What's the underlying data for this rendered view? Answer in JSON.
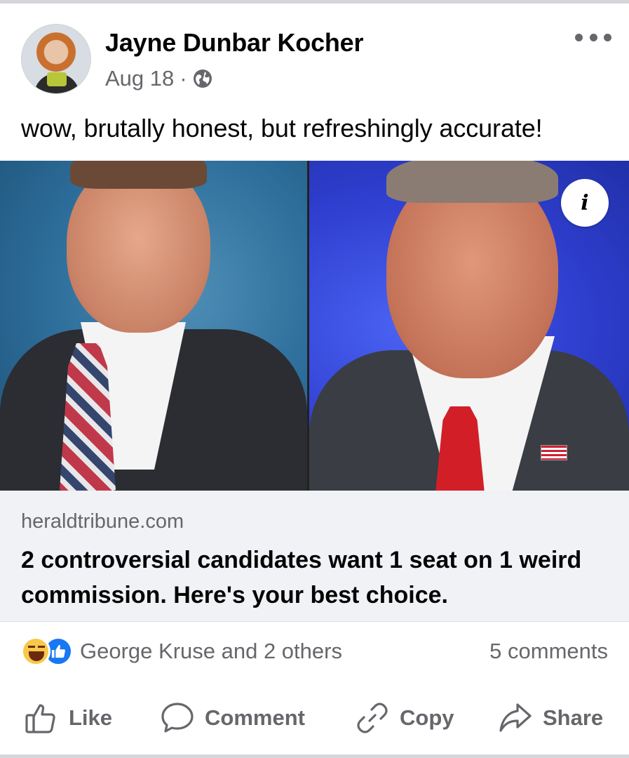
{
  "post": {
    "author": "Jayne Dunbar Kocher",
    "date": "Aug 18",
    "separator": "·",
    "audience_icon": "globe-icon",
    "text": "wow, brutally honest, but refreshingly accurate!"
  },
  "link": {
    "domain": "heraldtribune.com",
    "title": "2 controversial candidates want 1 seat on 1 weird commission. Here's your best choice.",
    "info_label": "i"
  },
  "engagement": {
    "reaction_icons": [
      "haha-reaction-icon",
      "like-reaction-icon"
    ],
    "reactions_text": "George Kruse and 2 others",
    "comments_text": "5 comments"
  },
  "actions": {
    "like": "Like",
    "comment": "Comment",
    "copy": "Copy",
    "share": "Share"
  },
  "colors": {
    "accent": "#1877f2",
    "secondary_text": "#65676b",
    "link_bg": "#f0f2f5"
  }
}
